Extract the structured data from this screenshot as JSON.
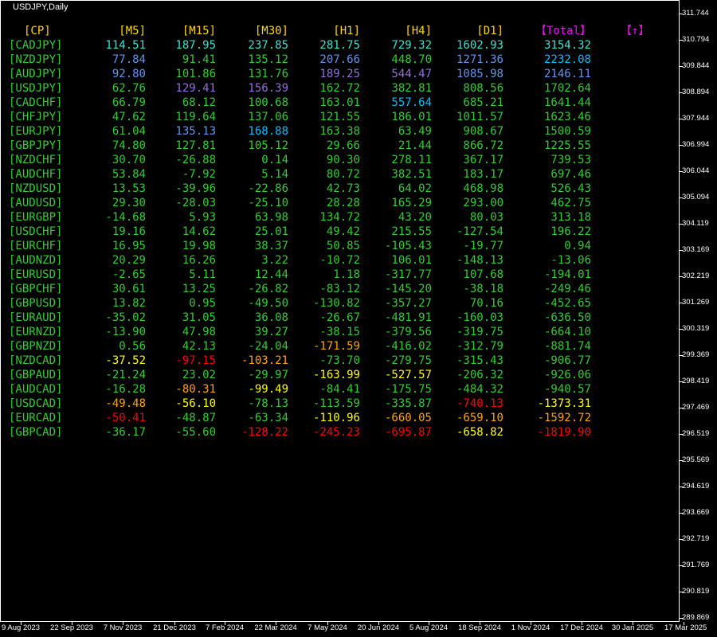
{
  "window": {
    "title": "USDJPY,Daily"
  },
  "price_axis": [
    "311.744",
    "310.794",
    "309.844",
    "308.894",
    "307.944",
    "306.994",
    "306.044",
    "305.094",
    "304.119",
    "303.169",
    "302.219",
    "301.269",
    "300.319",
    "299.369",
    "298.419",
    "297.469",
    "296.519",
    "295.569",
    "294.619",
    "293.669",
    "292.719",
    "291.769",
    "290.819",
    "289.869"
  ],
  "date_axis": [
    "9 Aug 2023",
    "22 Sep 2023",
    "7 Nov 2023",
    "21 Dec 2023",
    "7 Feb 2024",
    "22 Mar 2024",
    "7 May 2024",
    "20 Jun 2024",
    "5 Aug 2024",
    "18 Sep 2024",
    "1 Nov 2024",
    "17 Dec 2024",
    "30 Jan 2025",
    "17 Mar 2025"
  ],
  "headers": {
    "cp": "[CP]",
    "m5": "[M5]",
    "m15": "[M15]",
    "m30": "[M30]",
    "h1": "[H1]",
    "h4": "[H4]",
    "d1": "[D1]",
    "total": "【Total】",
    "arrow": "【↑】"
  },
  "colors": {
    "header": "#ffd700",
    "pair": "#32cd32",
    "total_header": "#ff00ff",
    "green": "#32cd32",
    "cyan": "#00bfff",
    "lightcyan": "#40e0d0",
    "blue": "#6495ed",
    "purple": "#9370db",
    "yellow": "#ffff00",
    "orange": "#ffa500",
    "red": "#ff0000",
    "white": "#ffffff"
  },
  "rows": [
    {
      "pair": "[CADJPY]",
      "v": [
        "114.51",
        "187.95",
        "237.85",
        "281.75",
        "729.32",
        "1602.93",
        "3154.32"
      ],
      "c": [
        "lightcyan",
        "lightcyan",
        "lightcyan",
        "lightcyan",
        "lightcyan",
        "lightcyan",
        "lightcyan"
      ]
    },
    {
      "pair": "[NZDJPY]",
      "v": [
        "77.84",
        "91.41",
        "135.12",
        "207.66",
        "448.70",
        "1271.36",
        "2232.08"
      ],
      "c": [
        "blue",
        "green",
        "green",
        "blue",
        "green",
        "blue",
        "cyan"
      ]
    },
    {
      "pair": "[AUDJPY]",
      "v": [
        "92.80",
        "101.86",
        "131.76",
        "189.25",
        "544.47",
        "1085.98",
        "2146.11"
      ],
      "c": [
        "blue",
        "green",
        "green",
        "purple",
        "purple",
        "blue",
        "blue"
      ]
    },
    {
      "pair": "[USDJPY]",
      "v": [
        "62.76",
        "129.41",
        "156.39",
        "162.72",
        "382.81",
        "808.56",
        "1702.64"
      ],
      "c": [
        "green",
        "purple",
        "purple",
        "green",
        "green",
        "green",
        "green"
      ]
    },
    {
      "pair": "[CADCHF]",
      "v": [
        "66.79",
        "68.12",
        "100.68",
        "163.01",
        "557.64",
        "685.21",
        "1641.44"
      ],
      "c": [
        "green",
        "green",
        "green",
        "green",
        "cyan",
        "green",
        "green"
      ]
    },
    {
      "pair": "[CHFJPY]",
      "v": [
        "47.62",
        "119.64",
        "137.06",
        "121.55",
        "186.01",
        "1011.57",
        "1623.46"
      ],
      "c": [
        "green",
        "green",
        "green",
        "green",
        "green",
        "green",
        "green"
      ]
    },
    {
      "pair": "[EURJPY]",
      "v": [
        "61.04",
        "135.13",
        "168.88",
        "163.38",
        "63.49",
        "908.67",
        "1500.59"
      ],
      "c": [
        "green",
        "blue",
        "cyan",
        "green",
        "green",
        "green",
        "green"
      ]
    },
    {
      "pair": "[GBPJPY]",
      "v": [
        "74.80",
        "127.81",
        "105.12",
        "29.66",
        "21.44",
        "866.72",
        "1225.55"
      ],
      "c": [
        "green",
        "green",
        "green",
        "green",
        "green",
        "green",
        "green"
      ]
    },
    {
      "pair": "[NZDCHF]",
      "v": [
        "30.70",
        "-26.88",
        "0.14",
        "90.30",
        "278.11",
        "367.17",
        "739.53"
      ],
      "c": [
        "green",
        "green",
        "green",
        "green",
        "green",
        "green",
        "green"
      ]
    },
    {
      "pair": "[AUDCHF]",
      "v": [
        "53.84",
        "-7.92",
        "5.14",
        "80.72",
        "382.51",
        "183.17",
        "697.46"
      ],
      "c": [
        "green",
        "green",
        "green",
        "green",
        "green",
        "green",
        "green"
      ]
    },
    {
      "pair": "[NZDUSD]",
      "v": [
        "13.53",
        "-39.96",
        "-22.86",
        "42.73",
        "64.02",
        "468.98",
        "526.43"
      ],
      "c": [
        "green",
        "green",
        "green",
        "green",
        "green",
        "green",
        "green"
      ]
    },
    {
      "pair": "[AUDUSD]",
      "v": [
        "29.30",
        "-28.03",
        "-25.10",
        "28.28",
        "165.29",
        "293.00",
        "462.75"
      ],
      "c": [
        "green",
        "green",
        "green",
        "green",
        "green",
        "green",
        "green"
      ]
    },
    {
      "pair": "[EURGBP]",
      "v": [
        "-14.68",
        "5.93",
        "63.98",
        "134.72",
        "43.20",
        "80.03",
        "313.18"
      ],
      "c": [
        "green",
        "green",
        "green",
        "green",
        "green",
        "green",
        "green"
      ]
    },
    {
      "pair": "[USDCHF]",
      "v": [
        "19.16",
        "14.62",
        "25.01",
        "49.42",
        "215.55",
        "-127.54",
        "196.22"
      ],
      "c": [
        "green",
        "green",
        "green",
        "green",
        "green",
        "green",
        "green"
      ]
    },
    {
      "pair": "[EURCHF]",
      "v": [
        "16.95",
        "19.98",
        "38.37",
        "50.85",
        "-105.43",
        "-19.77",
        "0.94"
      ],
      "c": [
        "green",
        "green",
        "green",
        "green",
        "green",
        "green",
        "green"
      ]
    },
    {
      "pair": "[AUDNZD]",
      "v": [
        "20.29",
        "16.26",
        "3.22",
        "-10.72",
        "106.01",
        "-148.13",
        "-13.06"
      ],
      "c": [
        "green",
        "green",
        "green",
        "green",
        "green",
        "green",
        "green"
      ]
    },
    {
      "pair": "[EURUSD]",
      "v": [
        "-2.65",
        "5.11",
        "12.44",
        "1.18",
        "-317.77",
        "107.68",
        "-194.01"
      ],
      "c": [
        "green",
        "green",
        "green",
        "green",
        "green",
        "green",
        "green"
      ]
    },
    {
      "pair": "[GBPCHF]",
      "v": [
        "30.61",
        "13.25",
        "-26.82",
        "-83.12",
        "-145.20",
        "-38.18",
        "-249.46"
      ],
      "c": [
        "green",
        "green",
        "green",
        "green",
        "green",
        "green",
        "green"
      ]
    },
    {
      "pair": "[GBPUSD]",
      "v": [
        "13.82",
        "0.95",
        "-49.50",
        "-130.82",
        "-357.27",
        "70.16",
        "-452.65"
      ],
      "c": [
        "green",
        "green",
        "green",
        "green",
        "green",
        "green",
        "green"
      ]
    },
    {
      "pair": "[EURAUD]",
      "v": [
        "-35.02",
        "31.05",
        "36.08",
        "-26.67",
        "-481.91",
        "-160.03",
        "-636.50"
      ],
      "c": [
        "green",
        "green",
        "green",
        "green",
        "green",
        "green",
        "green"
      ]
    },
    {
      "pair": "[EURNZD]",
      "v": [
        "-13.90",
        "47.98",
        "39.27",
        "-38.15",
        "-379.56",
        "-319.75",
        "-664.10"
      ],
      "c": [
        "green",
        "green",
        "green",
        "green",
        "green",
        "green",
        "green"
      ]
    },
    {
      "pair": "[GBPNZD]",
      "v": [
        "0.56",
        "42.13",
        "-24.04",
        "-171.59",
        "-416.02",
        "-312.79",
        "-881.74"
      ],
      "c": [
        "green",
        "green",
        "green",
        "orange",
        "green",
        "green",
        "green"
      ]
    },
    {
      "pair": "[NZDCAD]",
      "v": [
        "-37.52",
        "-97.15",
        "-103.21",
        "-73.70",
        "-279.75",
        "-315.43",
        "-906.77"
      ],
      "c": [
        "yellow",
        "red",
        "orange",
        "green",
        "green",
        "green",
        "green"
      ]
    },
    {
      "pair": "[GBPAUD]",
      "v": [
        "-21.24",
        "23.02",
        "-29.97",
        "-163.99",
        "-527.57",
        "-206.32",
        "-926.06"
      ],
      "c": [
        "green",
        "green",
        "green",
        "yellow",
        "yellow",
        "green",
        "green"
      ]
    },
    {
      "pair": "[AUDCAD]",
      "v": [
        "-16.28",
        "-80.31",
        "-99.49",
        "-84.41",
        "-175.75",
        "-484.32",
        "-940.57"
      ],
      "c": [
        "green",
        "orange",
        "yellow",
        "green",
        "green",
        "green",
        "green"
      ]
    },
    {
      "pair": "[USDCAD]",
      "v": [
        "-49.48",
        "-56.10",
        "-78.13",
        "-113.59",
        "-335.87",
        "-740.13",
        "-1373.31"
      ],
      "c": [
        "orange",
        "yellow",
        "green",
        "green",
        "green",
        "red",
        "yellow"
      ]
    },
    {
      "pair": "[EURCAD]",
      "v": [
        "-50.41",
        "-48.87",
        "-63.34",
        "-110.96",
        "-660.05",
        "-659.10",
        "-1592.72"
      ],
      "c": [
        "red",
        "green",
        "green",
        "yellow",
        "orange",
        "orange",
        "orange"
      ]
    },
    {
      "pair": "[GBPCAD]",
      "v": [
        "-36.17",
        "-55.60",
        "-128.22",
        "-245.23",
        "-695.87",
        "-658.82",
        "-1819.90"
      ],
      "c": [
        "green",
        "green",
        "red",
        "red",
        "red",
        "yellow",
        "red"
      ]
    }
  ]
}
